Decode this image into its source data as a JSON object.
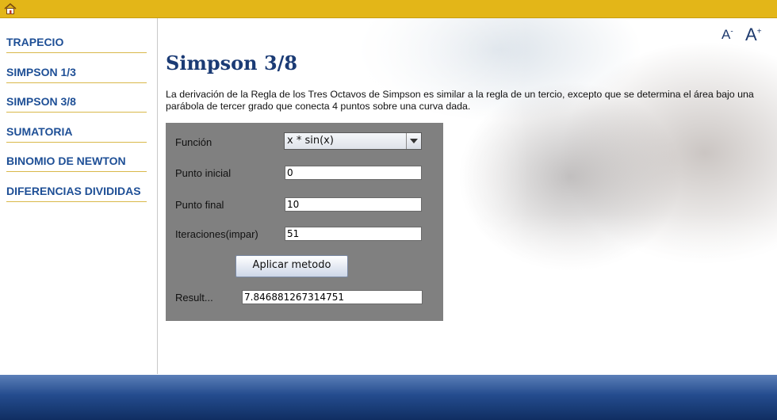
{
  "topbar": {
    "home_icon": "home-icon"
  },
  "sidebar": {
    "items": [
      {
        "label": "TRAPECIO"
      },
      {
        "label": "SIMPSON 1/3"
      },
      {
        "label": "SIMPSON 3/8"
      },
      {
        "label": "SUMATORIA"
      },
      {
        "label": "BINOMIO DE NEWTON"
      },
      {
        "label": "DIFERENCIAS DIVIDIDAS"
      }
    ]
  },
  "font_controls": {
    "decrease": "A",
    "decrease_sign": "-",
    "increase": "A",
    "increase_sign": "+"
  },
  "main": {
    "title": "Simpson 3/8",
    "description": "La derivación de la Regla de los Tres Octavos de Simpson es similar a la regla de un tercio, excepto que se determina el área bajo una parábola de tercer grado que conecta 4 puntos sobre una curva dada."
  },
  "form": {
    "funcion_label": "Función",
    "funcion_value": "x * sin(x)",
    "punto_inicial_label": "Punto inicial",
    "punto_inicial_value": "0",
    "punto_final_label": "Punto final",
    "punto_final_value": "10",
    "iteraciones_label": "Iteraciones(impar)",
    "iteraciones_value": "51",
    "apply_button": "Aplicar metodo",
    "result_label": "Result...",
    "result_value": "7.846881267314751"
  },
  "colors": {
    "topbar": "#e3b618",
    "sidebar_link": "#1e4f96",
    "title": "#1b3b75",
    "panel": "#808080",
    "footer": "#244c8e"
  }
}
